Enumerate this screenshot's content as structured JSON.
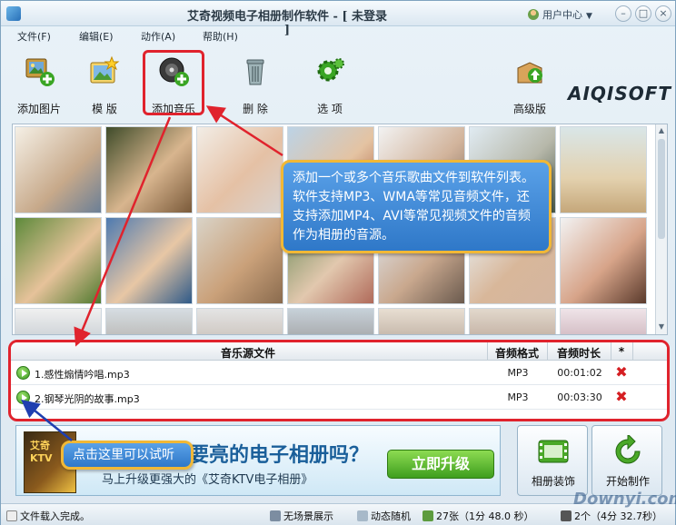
{
  "window": {
    "title": "艾奇视频电子相册制作软件 - [ 未登录 ]",
    "user_center": "用户中心",
    "minimize": "–",
    "maximize": "□",
    "close": "×"
  },
  "menu": {
    "items": [
      {
        "label": "文件(F)"
      },
      {
        "label": "编辑(E)"
      },
      {
        "label": "动作(A)"
      },
      {
        "label": "帮助(H)"
      }
    ]
  },
  "toolbar": {
    "add_image": "添加图片",
    "template": "模 版",
    "add_music": "添加音乐",
    "delete": "删 除",
    "options": "选 项",
    "advanced": "高级版",
    "logo": "AIQISOFT"
  },
  "callouts": {
    "music_help": "添加一个或多个音乐歌曲文件到软件列表。软件支持MP3、WMA等常见音频文件，还支持添加MP4、AVI等常见视频文件的音频作为相册的音源。",
    "preview_help": "点击这里可以试听"
  },
  "music_table": {
    "headers": {
      "file": "音乐源文件",
      "format": "音频格式",
      "duration": "音频时长",
      "star": "*"
    },
    "rows": [
      {
        "name": "1.感性煽情吟唱.mp3",
        "format": "MP3",
        "duration": "00:01:02"
      },
      {
        "name": "2.钢琴光阴的故事.mp3",
        "format": "MP3",
        "duration": "00:03:30"
      }
    ]
  },
  "banner": {
    "box_text": "艾奇 KTV",
    "title": "要亮的电子相册吗？",
    "subtitle": "马上升级更强大的《艾奇KTV电子相册》",
    "upgrade": "立即升级"
  },
  "buttons": {
    "decorate": "相册装饰",
    "start": "开始制作"
  },
  "status": {
    "message": "文件载入完成。",
    "scene": "无场景展示",
    "random": "动态随机",
    "photos": "27张（1分 48.0 秒）",
    "music": "2个（4分 32.7秒）",
    "watermark": "Downyi.com"
  },
  "colors": {
    "callout_bg": "#3c87d8",
    "callout_border": "#f1b836",
    "highlight_red": "#e0232d",
    "delete_red": "#d51e22"
  }
}
